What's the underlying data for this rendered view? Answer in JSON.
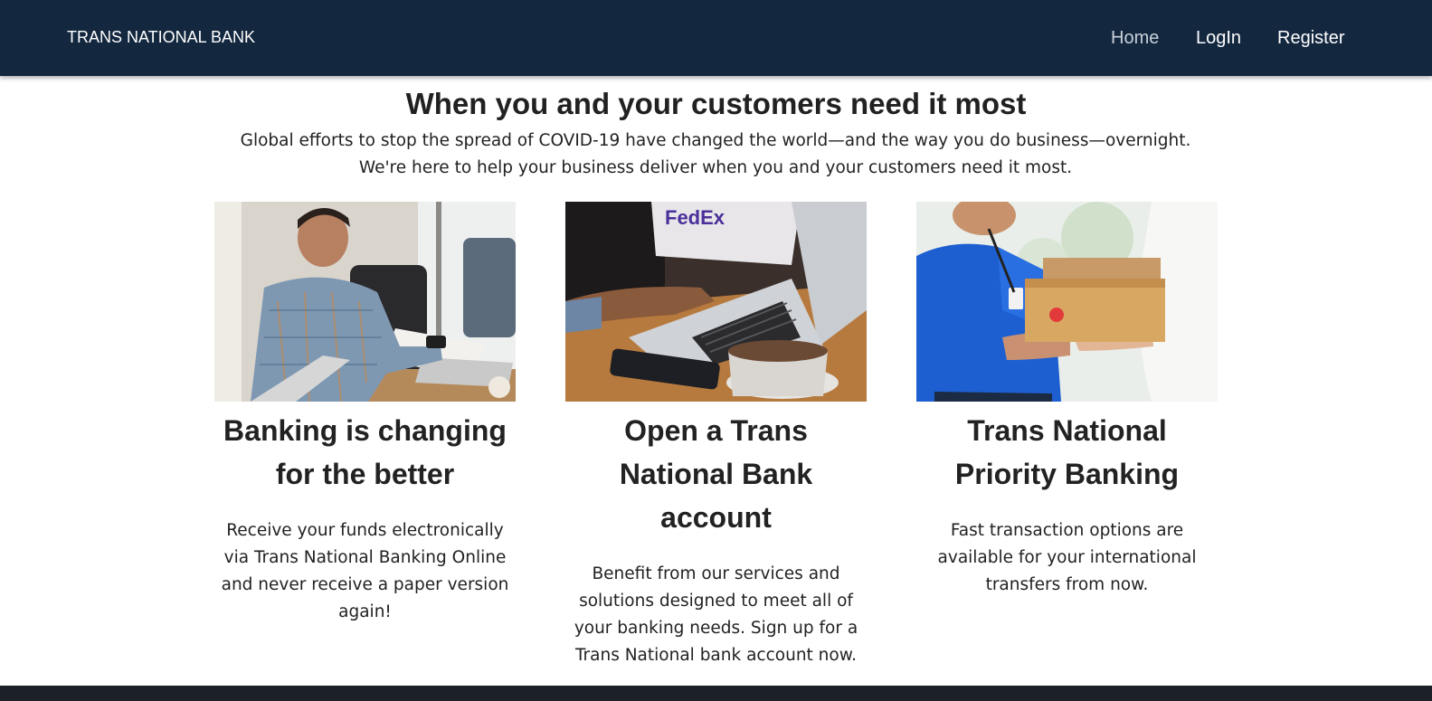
{
  "nav": {
    "brand": "TRANS NATIONAL BANK",
    "links": [
      {
        "label": "Home"
      },
      {
        "label": "LogIn"
      },
      {
        "label": "Register"
      }
    ]
  },
  "hero": {
    "title": "When you and your customers need it most",
    "text": "Global efforts to stop the spread of COVID-19 have changed the world—and the way you do business—overnight. We're here to help your business deliver when you and your customers need it most."
  },
  "cards": [
    {
      "title": "Banking is changing for the better",
      "text": "Receive your funds electronically via Trans National Banking Online and never receive a paper version again!"
    },
    {
      "title": "Open a Trans National Bank account",
      "text": "Benefit from our services and solutions designed to meet all of your banking needs. Sign up for a Trans National bank account now."
    },
    {
      "title": "Trans National Priority Banking",
      "text": "Fast transaction options are available for your international transfers from now."
    }
  ],
  "colors": {
    "navbar": "#13273f",
    "footer": "#1b2029",
    "active_link": "#c9d1db"
  }
}
